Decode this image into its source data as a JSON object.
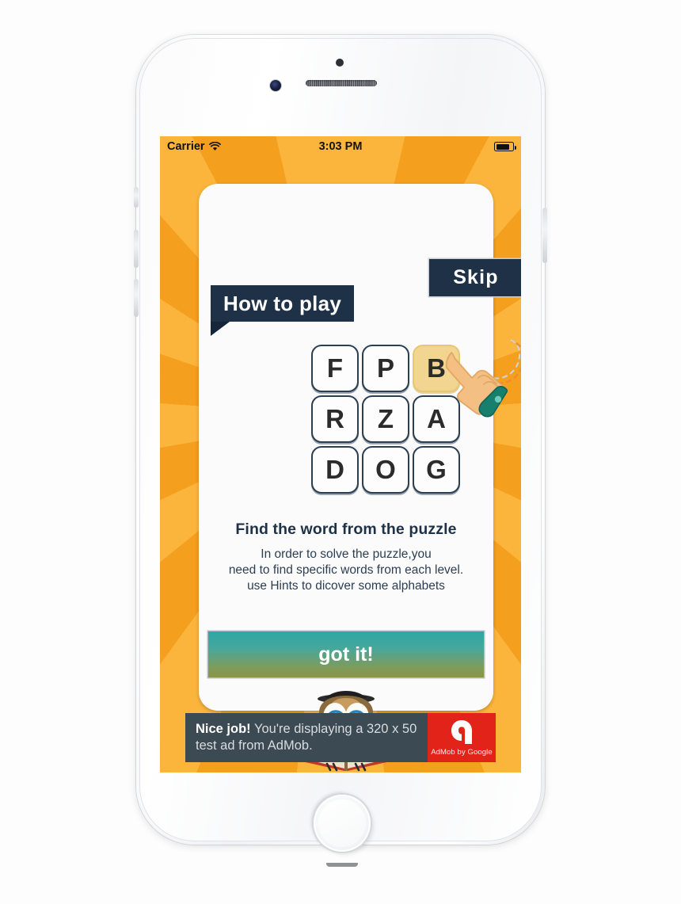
{
  "device": {
    "name": "iphone-white",
    "speaker": "earpiece-speaker",
    "camera": "front-camera",
    "home_button": "home-button"
  },
  "status_bar": {
    "carrier": "Carrier",
    "wifi_icon": "wifi-icon",
    "time": "3:03 PM",
    "battery_icon": "battery-icon"
  },
  "screen": {
    "background": {
      "style": "sunburst",
      "base_color": "#F4A62A",
      "ray_color": "#FBB53C"
    }
  },
  "card": {
    "ribbon_title": "How to play",
    "skip_label": "Skip",
    "headline": "Find the word from the puzzle",
    "body_lines": [
      "In order to solve the puzzle,you",
      "need to find specific words from each level.",
      "use Hints to dicover some alphabets"
    ],
    "cta_label": "got it!",
    "mascot": "owl-with-book-icon"
  },
  "puzzle": {
    "rows": [
      [
        {
          "letter": "F",
          "highlighted": false
        },
        {
          "letter": "P",
          "highlighted": false
        },
        {
          "letter": "B",
          "highlighted": true
        }
      ],
      [
        {
          "letter": "R",
          "highlighted": false
        },
        {
          "letter": "Z",
          "highlighted": false
        },
        {
          "letter": "A",
          "highlighted": false
        }
      ],
      [
        {
          "letter": "D",
          "highlighted": false
        },
        {
          "letter": "O",
          "highlighted": false
        },
        {
          "letter": "G",
          "highlighted": false
        }
      ]
    ],
    "pointer": "tap-hand-icon",
    "highlight_color": "#F2D590",
    "tile_border_color": "#2B3E52"
  },
  "ad": {
    "headline": "Nice job!",
    "message": "You're displaying a 320 x 50 test ad from AdMob.",
    "logo_label": "AdMob by Google",
    "logo_icon": "admob-logo-icon",
    "background": "#3C4A54",
    "logo_background": "#E2231A"
  },
  "colors": {
    "navy": "#1E3146",
    "orange": "#F4A62A",
    "teal": "#2FA6A6",
    "olive": "#8C9443"
  }
}
